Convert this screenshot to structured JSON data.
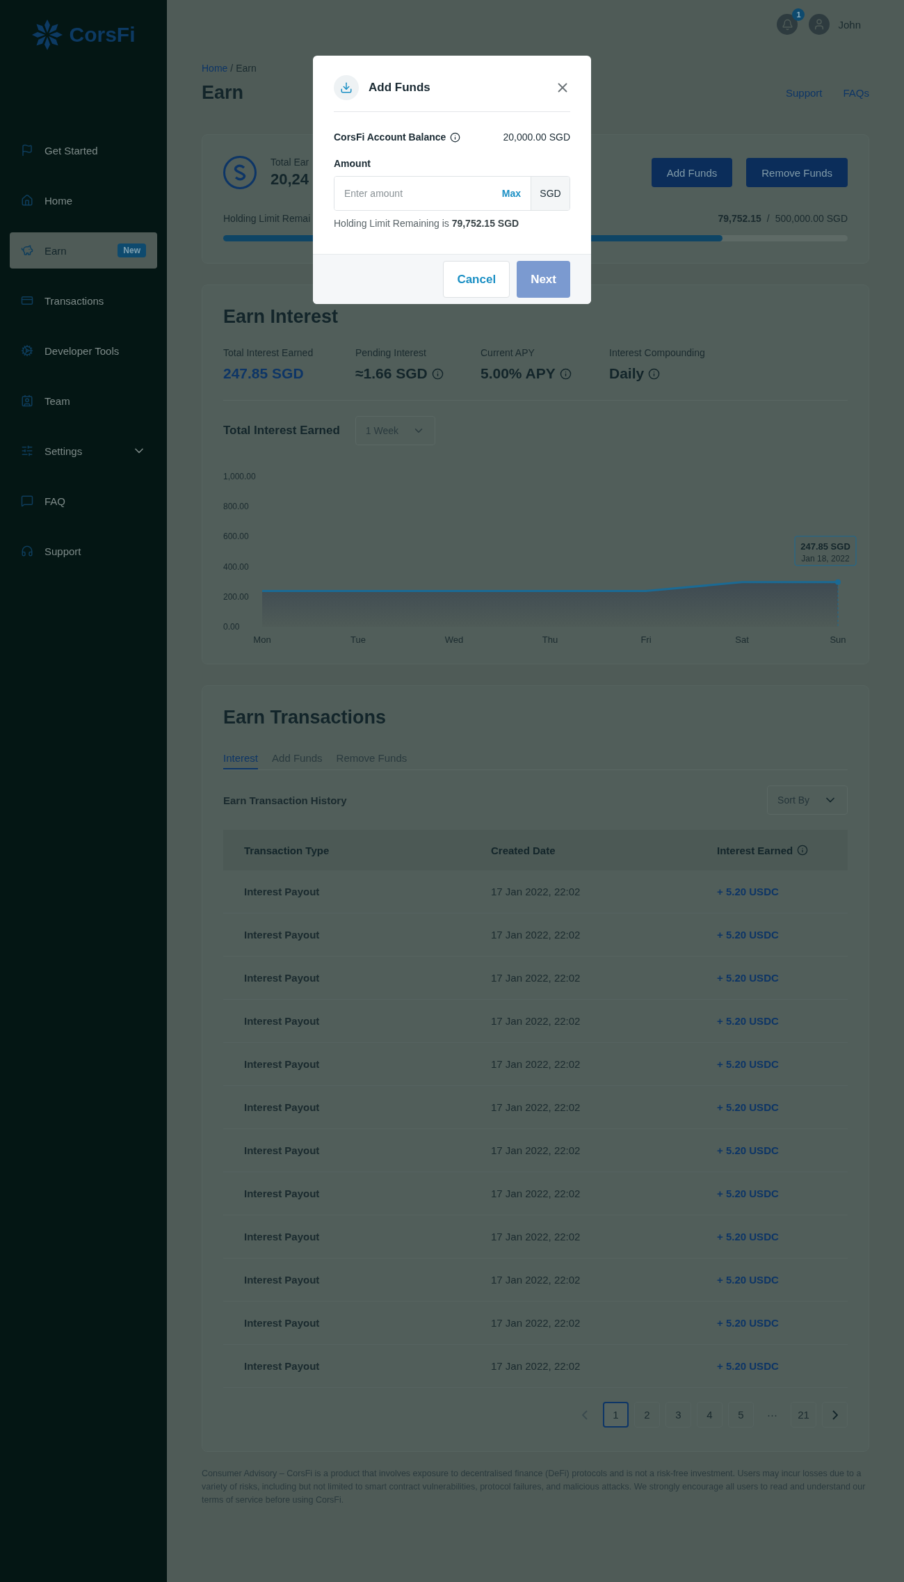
{
  "sidebar": {
    "logo": "CorsFi",
    "items": [
      {
        "label": "Get Started",
        "selected": false,
        "submenu": false
      },
      {
        "label": "Home",
        "selected": false,
        "submenu": false
      },
      {
        "label": "Earn",
        "selected": true,
        "submenu": false,
        "badge": "New"
      },
      {
        "label": "Transactions",
        "selected": false,
        "submenu": false
      },
      {
        "label": "Developer Tools",
        "selected": false,
        "submenu": false
      },
      {
        "label": "Team",
        "selected": false,
        "submenu": false
      },
      {
        "label": "Settings",
        "selected": false,
        "submenu": true
      },
      {
        "label": "FAQ",
        "selected": false,
        "submenu": false
      },
      {
        "label": "Support",
        "selected": false,
        "submenu": false
      }
    ]
  },
  "header": {
    "notifications": "1",
    "user": "John"
  },
  "breadcrumb": [
    "Home",
    "Earn"
  ],
  "breadcrumb_separator": "/",
  "title": "Earn",
  "links": [
    "Support",
    "FAQs"
  ],
  "balance_card": {
    "label": "Total Ear",
    "amount": "20,24",
    "buttons": [
      "Add Funds",
      "Remove Funds"
    ],
    "holding_label": "Holding Limit Remai",
    "holding_used": "79,752.15",
    "holding_separator": "/",
    "holding_total": "500,000.00 SGD",
    "level": 0.8
  },
  "earn_interest": {
    "title": "Earn Interest",
    "stats": [
      {
        "label": "Total Interest Earned",
        "value": "247.85 SGD",
        "info": false,
        "emphasis": true
      },
      {
        "label": "Pending Interest",
        "value": "≈1.66 SGD",
        "info": true,
        "emphasis": false
      },
      {
        "label": "Current APY",
        "value": "5.00% APY",
        "info": true,
        "emphasis": false
      },
      {
        "label": "Interest Compounding",
        "value": "Daily",
        "info": true,
        "emphasis": false
      }
    ],
    "range": "1 Week",
    "chart_data": {
      "type": "area",
      "categories": [
        "Mon",
        "Tue",
        "Wed",
        "Thu",
        "Fri",
        "Sat",
        "Sun"
      ],
      "series": [
        {
          "name": "Total Interest Earned",
          "color": "#1b6a94",
          "values": [
            238,
            238,
            238,
            238,
            238,
            297,
            297
          ]
        }
      ],
      "ylim": [
        0,
        1000
      ],
      "yticks": [
        {
          "value": 0,
          "label": "0.00"
        },
        {
          "value": 200,
          "label": "200.00"
        },
        {
          "value": 400,
          "label": "400.00"
        },
        {
          "value": 600,
          "label": "600.00"
        },
        {
          "value": 800,
          "label": "800.00"
        },
        {
          "value": 1000,
          "label": "1,000.00"
        }
      ]
    },
    "tooltip": {
      "value": "247.85 SGD",
      "date": "Jan 18, 2022"
    }
  },
  "transactions": {
    "title": "Earn Transactions",
    "tabs": [
      {
        "label": "Interest",
        "selected": true
      },
      {
        "label": "Add Funds",
        "selected": false
      },
      {
        "label": "Remove Funds",
        "selected": false
      }
    ],
    "history_title": "Earn Transaction History",
    "sort_placeholder": "Sort By",
    "columns": [
      {
        "label": "Transaction Type",
        "info": false
      },
      {
        "label": "Created Date",
        "info": false
      },
      {
        "label": "Interest Earned",
        "info": true
      }
    ],
    "rows": [
      {
        "type": "Interest Payout",
        "date": "17 Jan 2022, 22:02",
        "amount": "+ 5.20 USDC"
      },
      {
        "type": "Interest Payout",
        "date": "17 Jan 2022, 22:02",
        "amount": "+ 5.20 USDC"
      },
      {
        "type": "Interest Payout",
        "date": "17 Jan 2022, 22:02",
        "amount": "+ 5.20 USDC"
      },
      {
        "type": "Interest Payout",
        "date": "17 Jan 2022, 22:02",
        "amount": "+ 5.20 USDC"
      },
      {
        "type": "Interest Payout",
        "date": "17 Jan 2022, 22:02",
        "amount": "+ 5.20 USDC"
      },
      {
        "type": "Interest Payout",
        "date": "17 Jan 2022, 22:02",
        "amount": "+ 5.20 USDC"
      },
      {
        "type": "Interest Payout",
        "date": "17 Jan 2022, 22:02",
        "amount": "+ 5.20 USDC"
      },
      {
        "type": "Interest Payout",
        "date": "17 Jan 2022, 22:02",
        "amount": "+ 5.20 USDC"
      },
      {
        "type": "Interest Payout",
        "date": "17 Jan 2022, 22:02",
        "amount": "+ 5.20 USDC"
      },
      {
        "type": "Interest Payout",
        "date": "17 Jan 2022, 22:02",
        "amount": "+ 5.20 USDC"
      },
      {
        "type": "Interest Payout",
        "date": "17 Jan 2022, 22:02",
        "amount": "+ 5.20 USDC"
      },
      {
        "type": "Interest Payout",
        "date": "17 Jan 2022, 22:02",
        "amount": "+ 5.20 USDC"
      }
    ],
    "pages": [
      {
        "label": "1",
        "kind": "page",
        "selected": true
      },
      {
        "label": "2",
        "kind": "page",
        "selected": false
      },
      {
        "label": "3",
        "kind": "page",
        "selected": false
      },
      {
        "label": "4",
        "kind": "page",
        "selected": false
      },
      {
        "label": "5",
        "kind": "page",
        "selected": false
      },
      {
        "label": "···",
        "kind": "gap"
      },
      {
        "label": "21",
        "kind": "page",
        "selected": false
      }
    ]
  },
  "advisory": "Consumer Advisory – CorsFi is a product that involves exposure to decentralised finance (DeFi) protocols and is not a risk-free investment. Users may incur losses due to a variety of risks, including but not limited to smart contract vulnerabilities, protocol failures, and malicious attacks. We strongly encourage all users to read and understand our terms of service before using CorsFi.",
  "modal": {
    "title": "Add Funds",
    "balance_label": "CorsFi Account Balance",
    "balance_value": "20,000.00 SGD",
    "amount_label": "Amount",
    "placeholder": "Enter amount",
    "max": "Max",
    "currency": "SGD",
    "hint": "Holding Limit Remaining is **79,752.15 SGD**",
    "cancel": "Cancel",
    "next": "Next",
    "next_disabled": true
  }
}
